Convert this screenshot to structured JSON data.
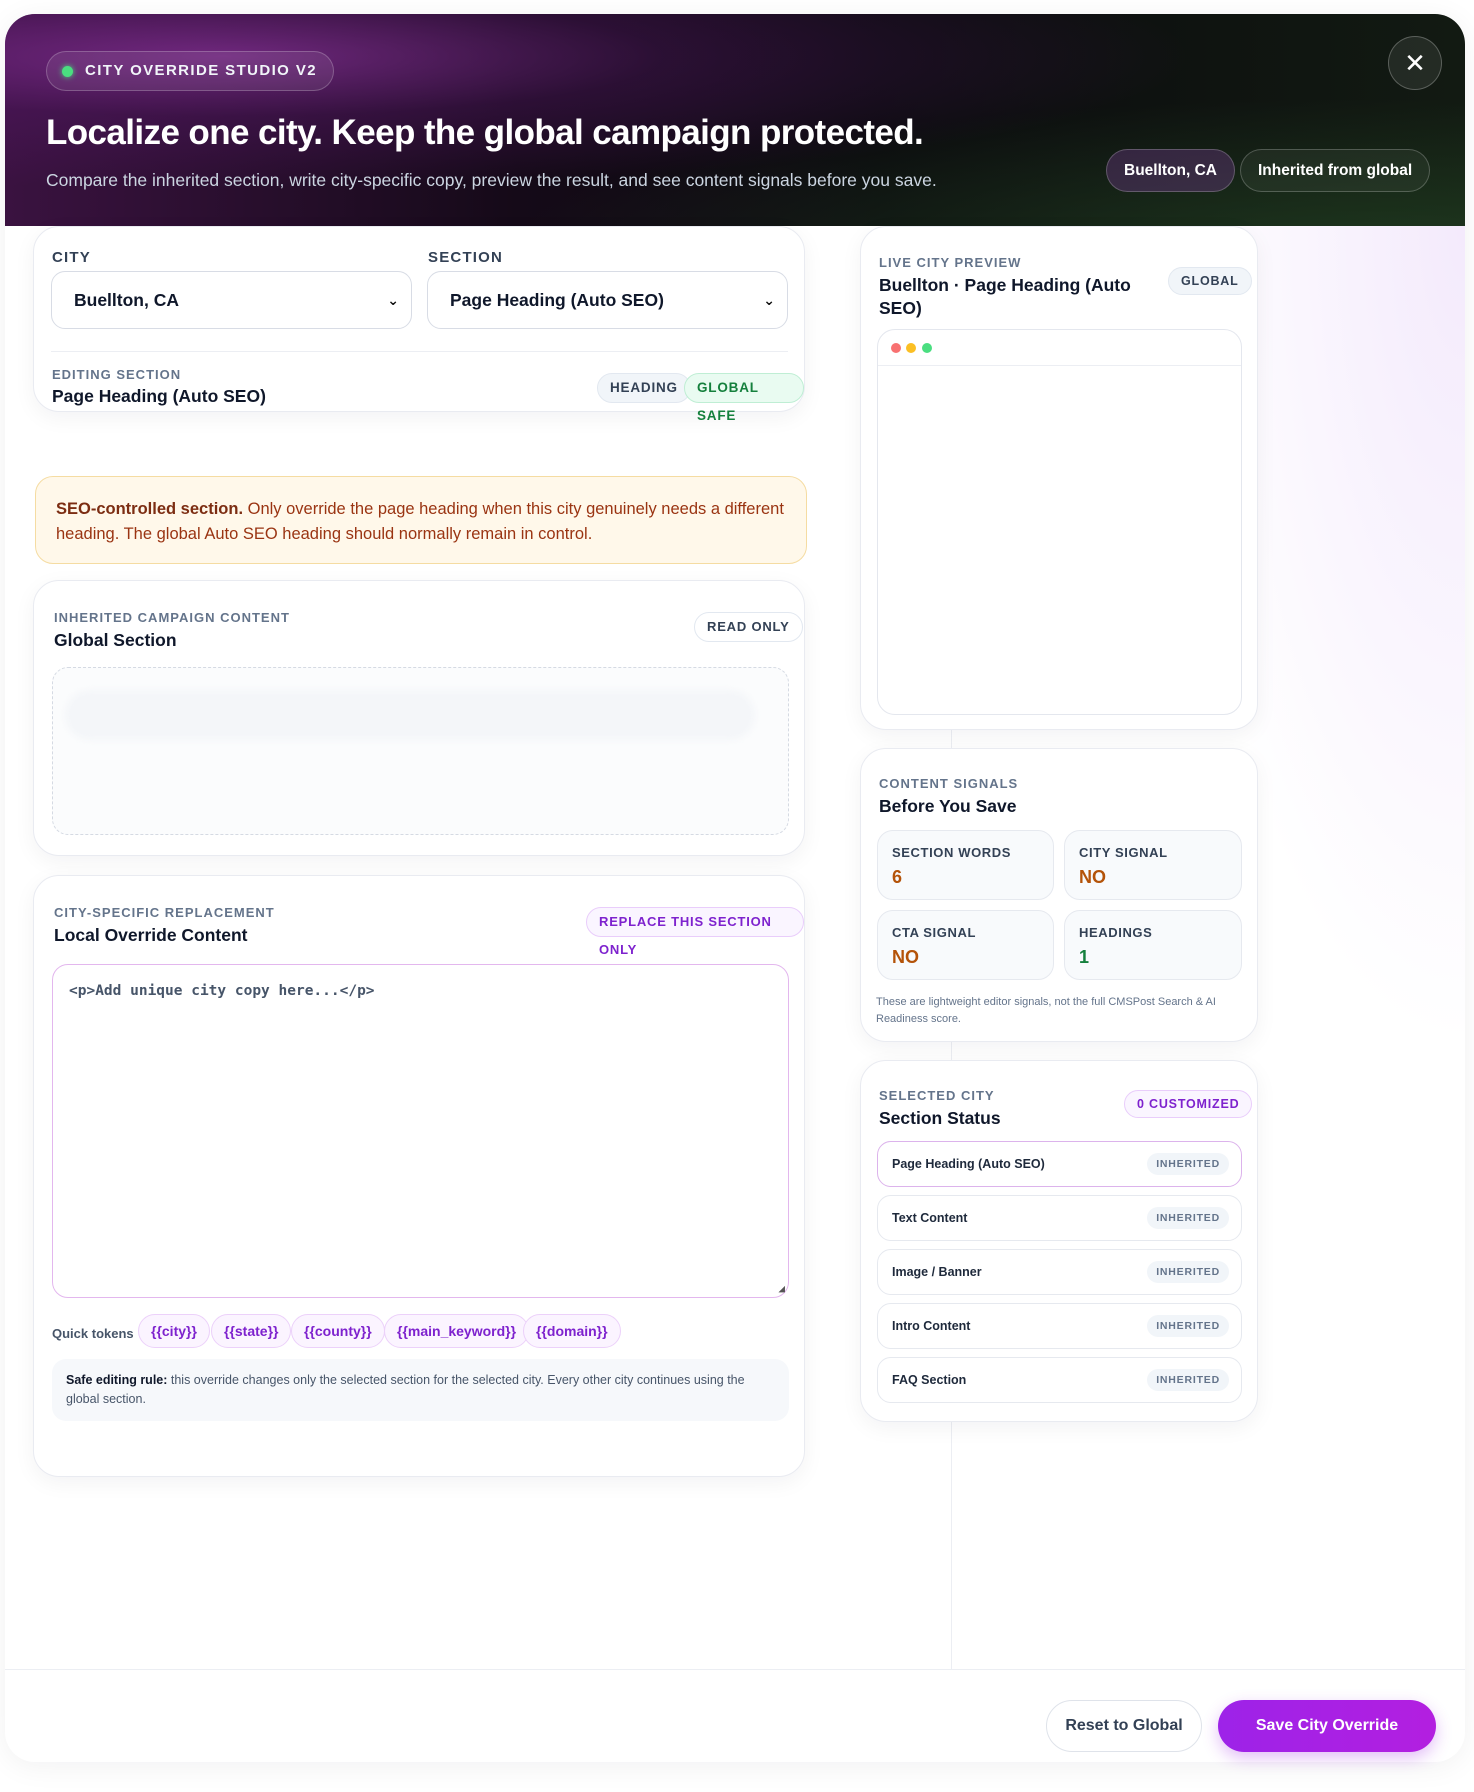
{
  "header": {
    "badge": "CITY OVERRIDE STUDIO V2",
    "title": "Localize one city. Keep the global campaign protected.",
    "subtitle": "Compare the inherited section, write city-specific copy, preview the result, and see content signals before you save.",
    "city_pill": "Buellton, CA",
    "status_pill": "Inherited from global",
    "close_glyph": "✕"
  },
  "selectors": {
    "city_label": "CITY",
    "city_value": "Buellton, CA",
    "section_label": "SECTION",
    "section_value": "Page Heading (Auto SEO)",
    "editing_label": "EDITING SECTION",
    "editing_value": "Page Heading (Auto SEO)",
    "chip_type": "HEADING",
    "chip_safe": "GLOBAL SAFE"
  },
  "warning": {
    "bold": "SEO-controlled section.",
    "text": " Only override the page heading when this city genuinely needs a different heading. The global Auto SEO heading should normally remain in control."
  },
  "inherited": {
    "label": "INHERITED CAMPAIGN CONTENT",
    "title": "Global Section",
    "chip": "READ ONLY"
  },
  "override": {
    "label": "CITY-SPECIFIC REPLACEMENT",
    "title": "Local Override Content",
    "chip": "REPLACE THIS SECTION ONLY",
    "placeholder": "<p>Add unique city copy here...</p>",
    "tokens_label": "Quick tokens",
    "tokens": [
      "{{city}}",
      "{{state}}",
      "{{county}}",
      "{{main_keyword}}",
      "{{domain}}"
    ],
    "rule_bold": "Safe editing rule:",
    "rule_text": " this override changes only the selected section for the selected city. Every other city continues using the global section."
  },
  "preview": {
    "label": "LIVE CITY PREVIEW",
    "title": "Buellton · Page Heading (Auto SEO)",
    "chip": "GLOBAL",
    "dot_colors": [
      "#f87171",
      "#fbbf24",
      "#4ade80"
    ]
  },
  "signals": {
    "label": "CONTENT SIGNALS",
    "title": "Before You Save",
    "items": [
      {
        "label": "SECTION WORDS",
        "value": "6"
      },
      {
        "label": "CITY SIGNAL",
        "value": "NO"
      },
      {
        "label": "CTA SIGNAL",
        "value": "NO"
      },
      {
        "label": "HEADINGS",
        "value": "1"
      }
    ],
    "note": "These are lightweight editor signals, not the full CMSPost Search & AI Readiness score."
  },
  "status": {
    "label": "SELECTED CITY",
    "title": "Section Status",
    "chip": "0 CUSTOMIZED",
    "rows": [
      {
        "name": "Page Heading (Auto SEO)",
        "state": "INHERITED"
      },
      {
        "name": "Text Content",
        "state": "INHERITED"
      },
      {
        "name": "Image / Banner",
        "state": "INHERITED"
      },
      {
        "name": "Intro Content",
        "state": "INHERITED"
      },
      {
        "name": "FAQ Section",
        "state": "INHERITED"
      }
    ]
  },
  "footer": {
    "reset": "Reset to Global",
    "save": "Save City Override"
  }
}
